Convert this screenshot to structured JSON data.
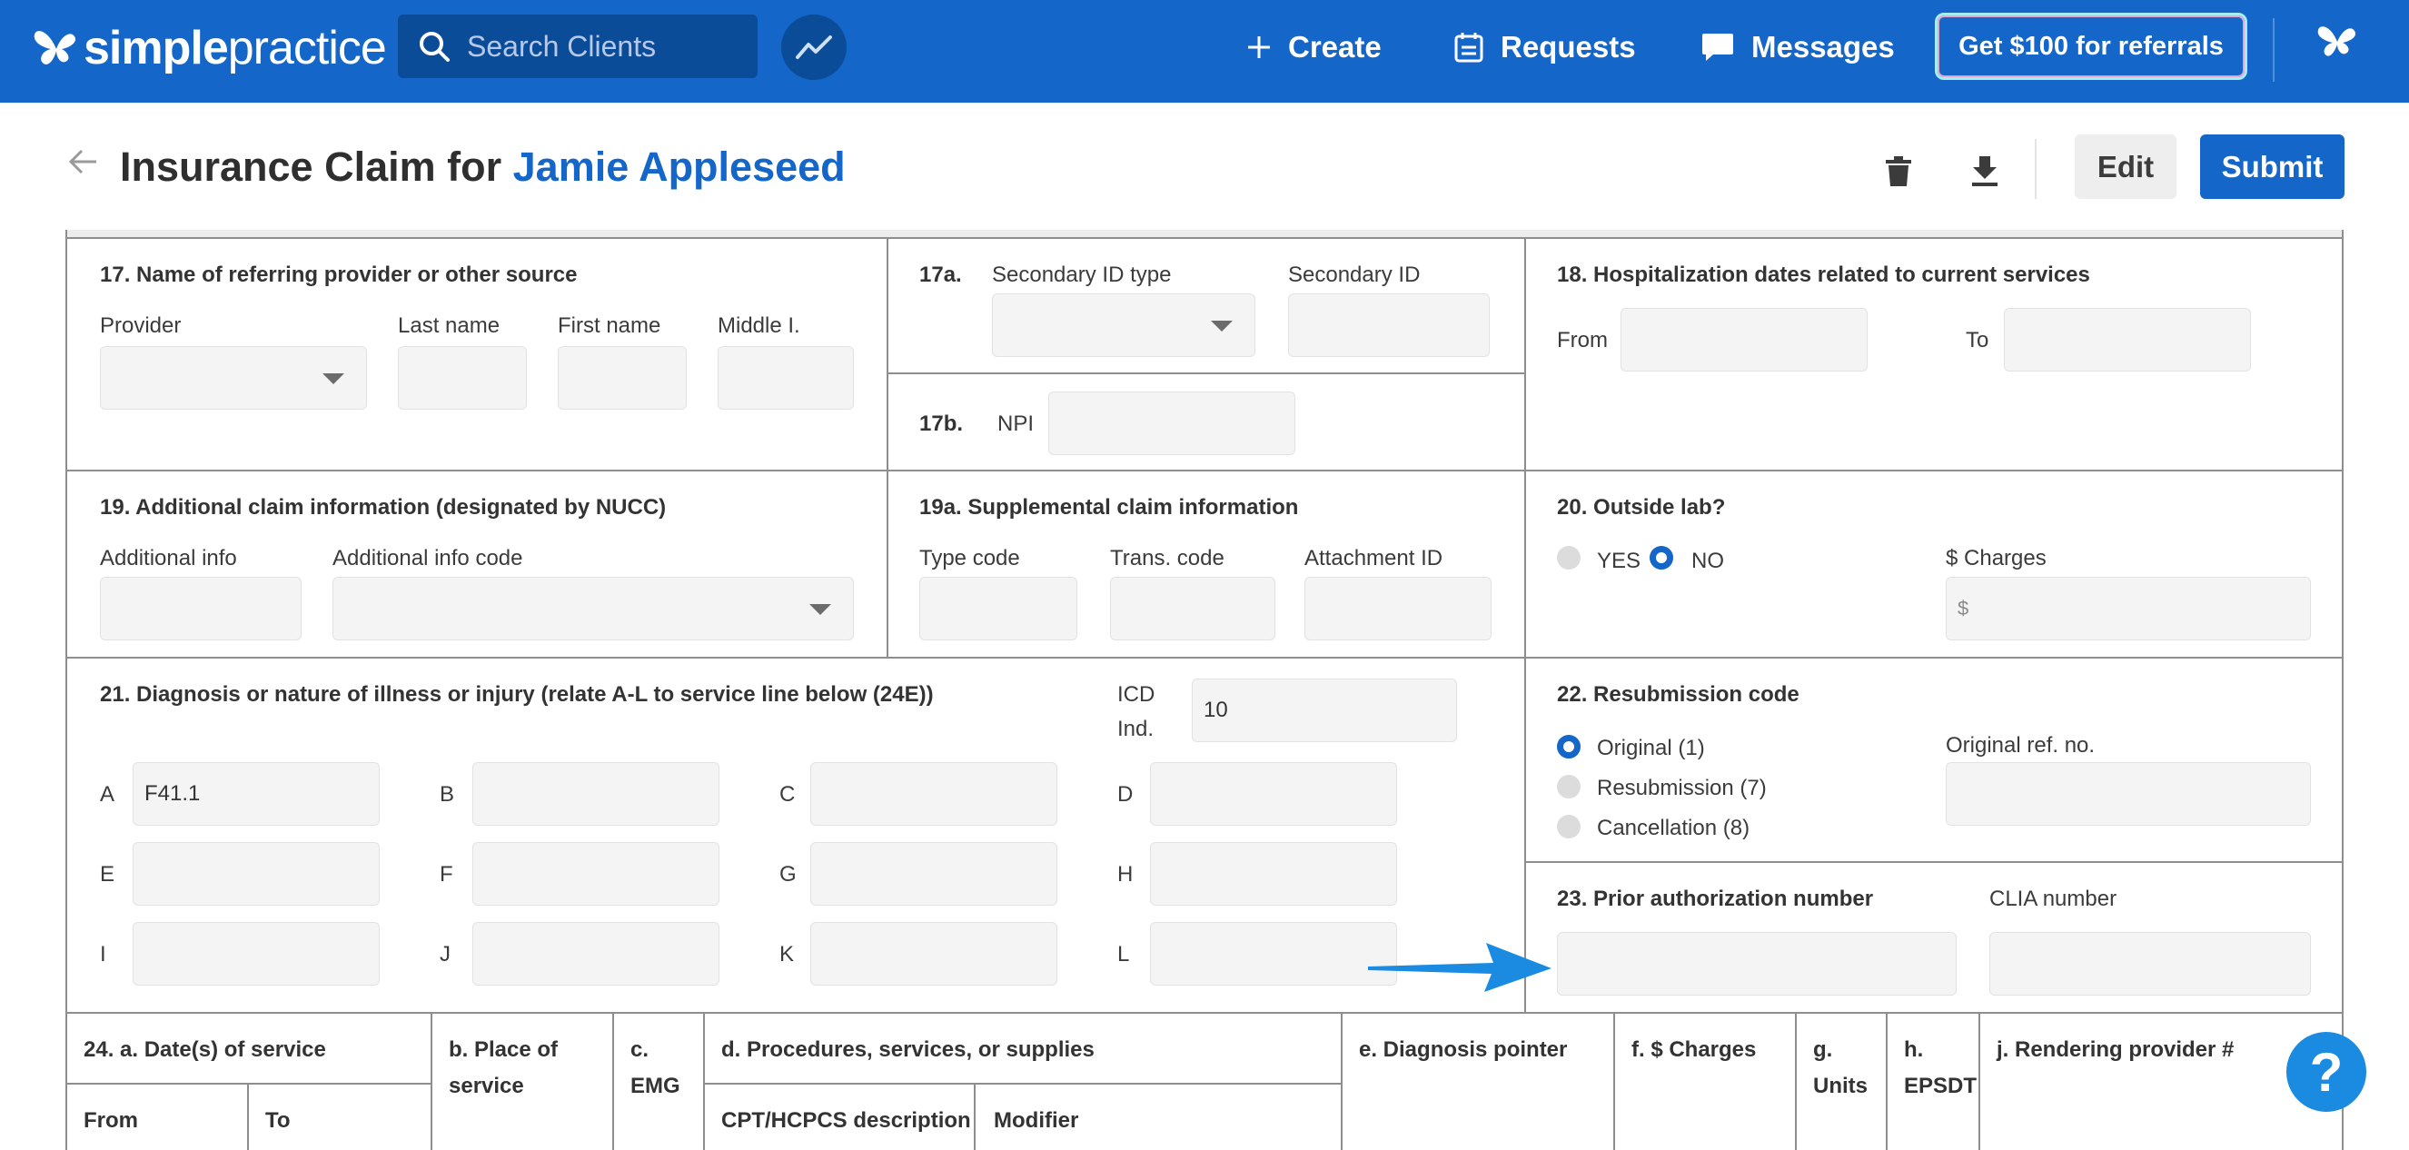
{
  "nav": {
    "logo_bold": "simple",
    "logo_light": "practice",
    "search_placeholder": "Search Clients",
    "create": "Create",
    "requests": "Requests",
    "messages": "Messages",
    "referral": "Get $100 for referrals"
  },
  "header": {
    "title_prefix": "Insurance Claim for",
    "client_name": "Jamie Appleseed",
    "edit": "Edit",
    "submit": "Submit"
  },
  "box17": {
    "title": "17. Name of referring provider or other source",
    "provider": "Provider",
    "last_name": "Last name",
    "first_name": "First name",
    "middle": "Middle I."
  },
  "box17a": {
    "num": "17a.",
    "secondary_id_type": "Secondary ID type",
    "secondary_id": "Secondary ID"
  },
  "box17b": {
    "num": "17b.",
    "npi": "NPI"
  },
  "box18": {
    "title": "18. Hospitalization dates related to current services",
    "from": "From",
    "to": "To"
  },
  "box19": {
    "title": "19. Additional claim information (designated by NUCC)",
    "info": "Additional info",
    "code": "Additional info code"
  },
  "box19a": {
    "title": "19a. Supplemental claim information",
    "type_code": "Type code",
    "trans_code": "Trans. code",
    "attachment": "Attachment ID"
  },
  "box20": {
    "title": "20. Outside lab?",
    "yes": "YES",
    "no": "NO",
    "selected": "NO",
    "charges": "$ Charges",
    "dollar": "$"
  },
  "box21": {
    "title": "21. Diagnosis or nature of illness or injury (relate A-L to service line below (24E))",
    "icd_label_1": "ICD",
    "icd_label_2": "Ind.",
    "icd_value": "10",
    "letters": [
      "A",
      "B",
      "C",
      "D",
      "E",
      "F",
      "G",
      "H",
      "I",
      "J",
      "K",
      "L"
    ],
    "values": [
      "F41.1",
      "",
      "",
      "",
      "",
      "",
      "",
      "",
      "",
      "",
      "",
      ""
    ]
  },
  "box22": {
    "title": "22. Resubmission code",
    "original": "Original (1)",
    "resubmission": "Resubmission (7)",
    "cancellation": "Cancellation (8)",
    "selected": "Original (1)",
    "orig_ref": "Original ref. no."
  },
  "box23": {
    "title": "23. Prior authorization number",
    "clia": "CLIA number"
  },
  "box24": {
    "a": "24. a. Date(s) of service",
    "from": "From",
    "to": "To",
    "b1": "b. Place of",
    "b2": "service",
    "c1": "c.",
    "c2": "EMG",
    "d": "d. Procedures, services, or supplies",
    "cpt": "CPT/HCPCS description",
    "modifier": "Modifier",
    "e": "e. Diagnosis pointer",
    "f": "f. $ Charges",
    "g1": "g.",
    "g2": "Units",
    "h1": "h.",
    "h2": "EPSDT",
    "j": "j. Rendering provider #"
  },
  "help": "?",
  "colors": {
    "brand": "#1466c8",
    "annotation_arrow": "#1a8be0"
  }
}
